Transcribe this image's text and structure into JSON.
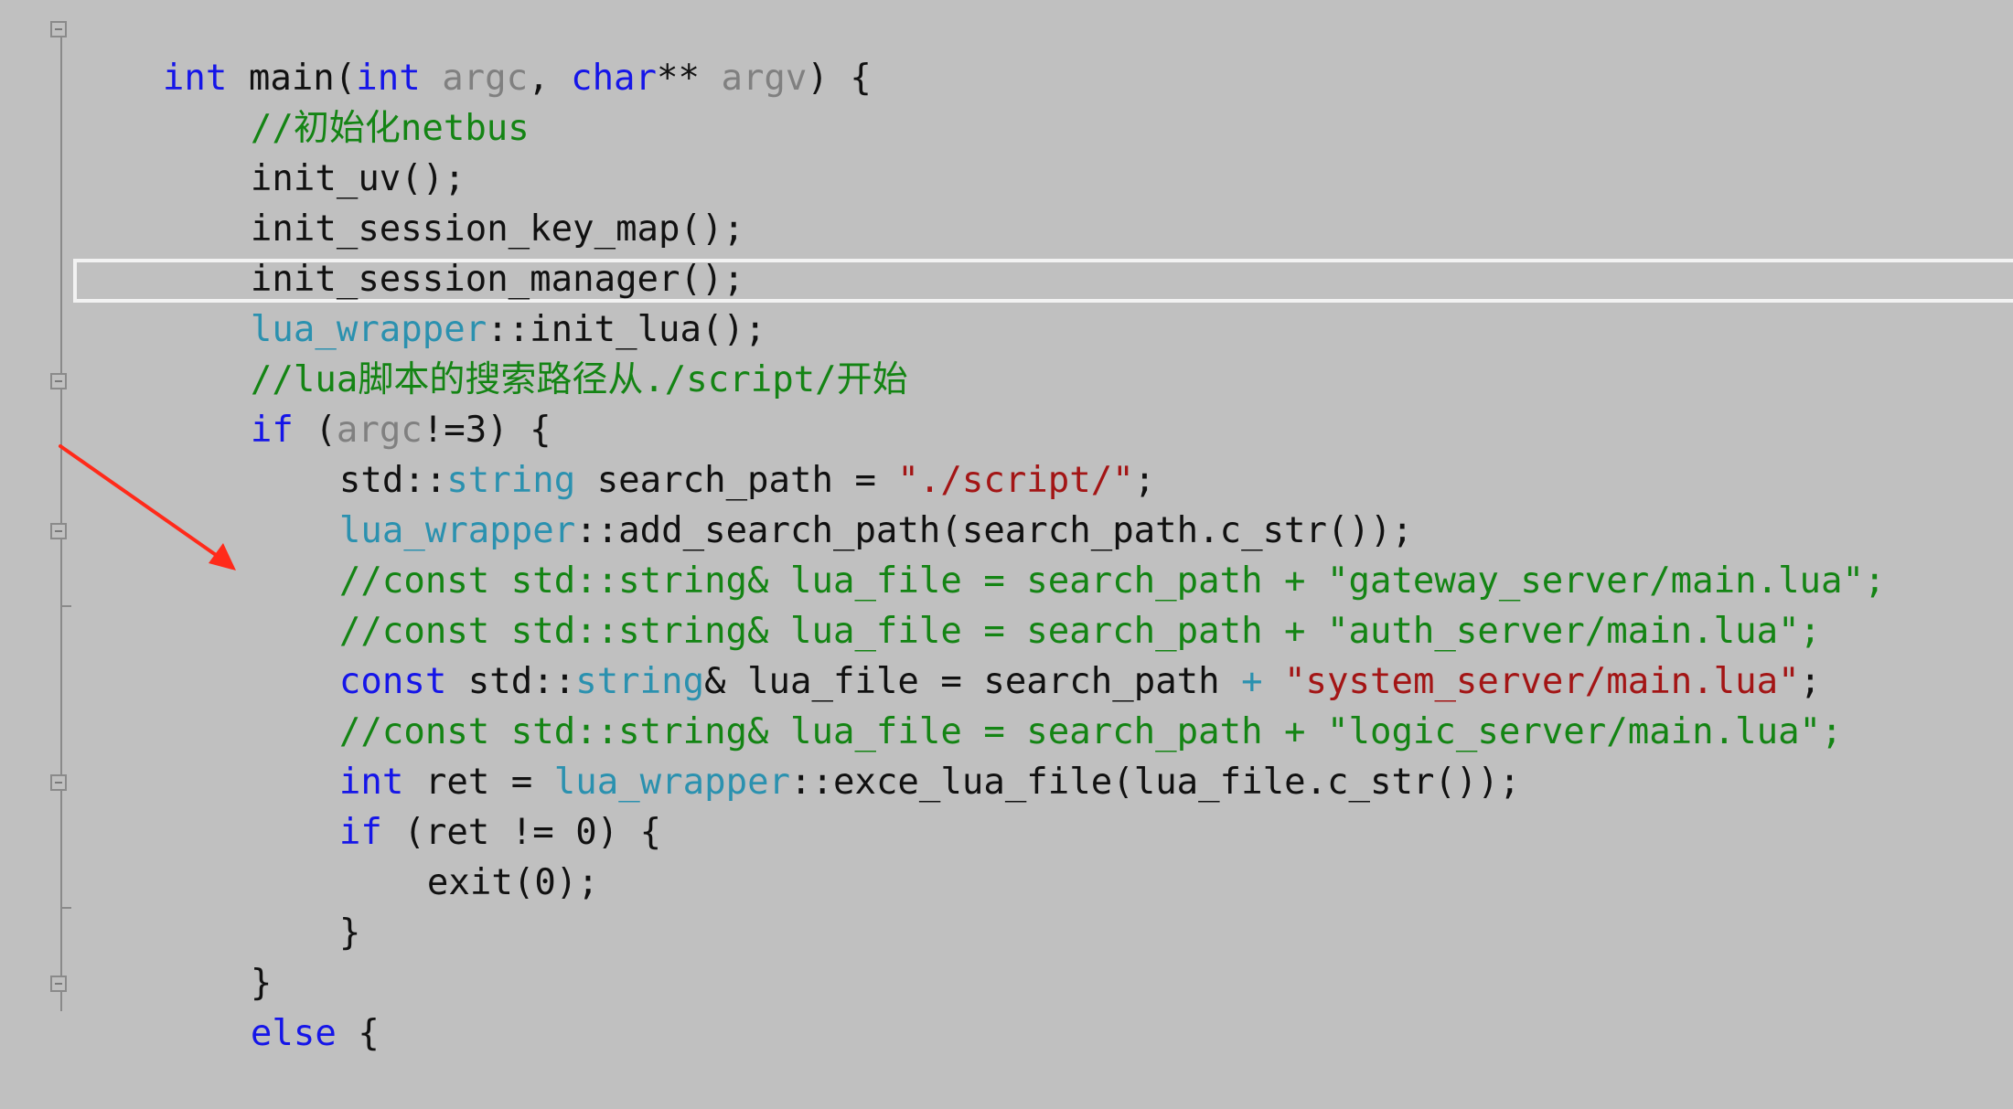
{
  "editor": {
    "lines": [
      {
        "tokens": [
          {
            "text": "int",
            "kind": "kw"
          },
          {
            "text": " main(",
            "kind": "plain"
          },
          {
            "text": "int",
            "kind": "kw"
          },
          {
            "text": " ",
            "kind": "plain"
          },
          {
            "text": "argc",
            "kind": "param"
          },
          {
            "text": ", ",
            "kind": "plain"
          },
          {
            "text": "char",
            "kind": "kw"
          },
          {
            "text": "** ",
            "kind": "plain"
          },
          {
            "text": "argv",
            "kind": "param"
          },
          {
            "text": ") {",
            "kind": "plain"
          }
        ]
      },
      {
        "tokens": [
          {
            "text": "//初始化netbus",
            "kind": "cmt"
          }
        ]
      },
      {
        "tokens": [
          {
            "text": "init_uv();",
            "kind": "plain"
          }
        ]
      },
      {
        "tokens": [
          {
            "text": "init_session_key_map();",
            "kind": "plain"
          }
        ]
      },
      {
        "tokens": [
          {
            "text": "init_session_manager();",
            "kind": "plain"
          }
        ]
      },
      {
        "tokens": [
          {
            "text": "lua_wrapper",
            "kind": "typ"
          },
          {
            "text": "::init_lua();",
            "kind": "plain"
          }
        ]
      },
      {
        "tokens": [
          {
            "text": "//lua脚本的搜索路径从./script/开始",
            "kind": "cmt"
          }
        ]
      },
      {
        "tokens": [
          {
            "text": "if",
            "kind": "kw"
          },
          {
            "text": " (",
            "kind": "plain"
          },
          {
            "text": "argc",
            "kind": "param"
          },
          {
            "text": "!=3) {",
            "kind": "plain"
          }
        ]
      },
      {
        "tokens": [
          {
            "text": "std::",
            "kind": "plain"
          },
          {
            "text": "string",
            "kind": "typ"
          },
          {
            "text": " search_path = ",
            "kind": "plain"
          },
          {
            "text": "\"./script/\"",
            "kind": "str"
          },
          {
            "text": ";",
            "kind": "plain"
          }
        ]
      },
      {
        "tokens": [
          {
            "text": "lua_wrapper",
            "kind": "typ"
          },
          {
            "text": "::add_search_path(search_path.c_str());",
            "kind": "plain"
          }
        ]
      },
      {
        "tokens": [
          {
            "text": "//const std::string& lua_file = search_path + \"gateway_server/main.lua\";",
            "kind": "cmt"
          }
        ]
      },
      {
        "tokens": [
          {
            "text": "//const std::string& lua_file = search_path + \"auth_server/main.lua\";",
            "kind": "cmt"
          }
        ]
      },
      {
        "tokens": [
          {
            "text": "const",
            "kind": "kw"
          },
          {
            "text": " std::",
            "kind": "plain"
          },
          {
            "text": "string",
            "kind": "typ"
          },
          {
            "text": "& lua_file = search_path ",
            "kind": "plain"
          },
          {
            "text": "+",
            "kind": "typ"
          },
          {
            "text": " ",
            "kind": "plain"
          },
          {
            "text": "\"system_server/main.lua\"",
            "kind": "str"
          },
          {
            "text": ";",
            "kind": "plain"
          }
        ]
      },
      {
        "tokens": [
          {
            "text": "//const std::string& lua_file = search_path + \"logic_server/main.lua\";",
            "kind": "cmt"
          }
        ]
      },
      {
        "tokens": [
          {
            "text": "int",
            "kind": "kw"
          },
          {
            "text": " ret = ",
            "kind": "plain"
          },
          {
            "text": "lua_wrapper",
            "kind": "typ"
          },
          {
            "text": "::exce_lua_file(lua_file.c_str());",
            "kind": "plain"
          }
        ]
      },
      {
        "tokens": [
          {
            "text": "if",
            "kind": "kw"
          },
          {
            "text": " (ret != 0) {",
            "kind": "plain"
          }
        ]
      },
      {
        "tokens": [
          {
            "text": "exit(0);",
            "kind": "plain"
          }
        ]
      },
      {
        "tokens": [
          {
            "text": "}",
            "kind": "plain"
          }
        ]
      },
      {
        "tokens": [
          {
            "text": "}",
            "kind": "plain"
          }
        ]
      },
      {
        "tokens": [
          {
            "text": "else",
            "kind": "kw"
          },
          {
            "text": " {",
            "kind": "plain"
          }
        ]
      }
    ]
  },
  "colors": {
    "background": "#c0c0c0",
    "keyword": "#1515e8",
    "type": "#2b91af",
    "parameter": "#808080",
    "comment": "#148414",
    "string": "#a31515",
    "arrow": "#ff2a1a",
    "current_line_border": "#f2f2f2"
  }
}
